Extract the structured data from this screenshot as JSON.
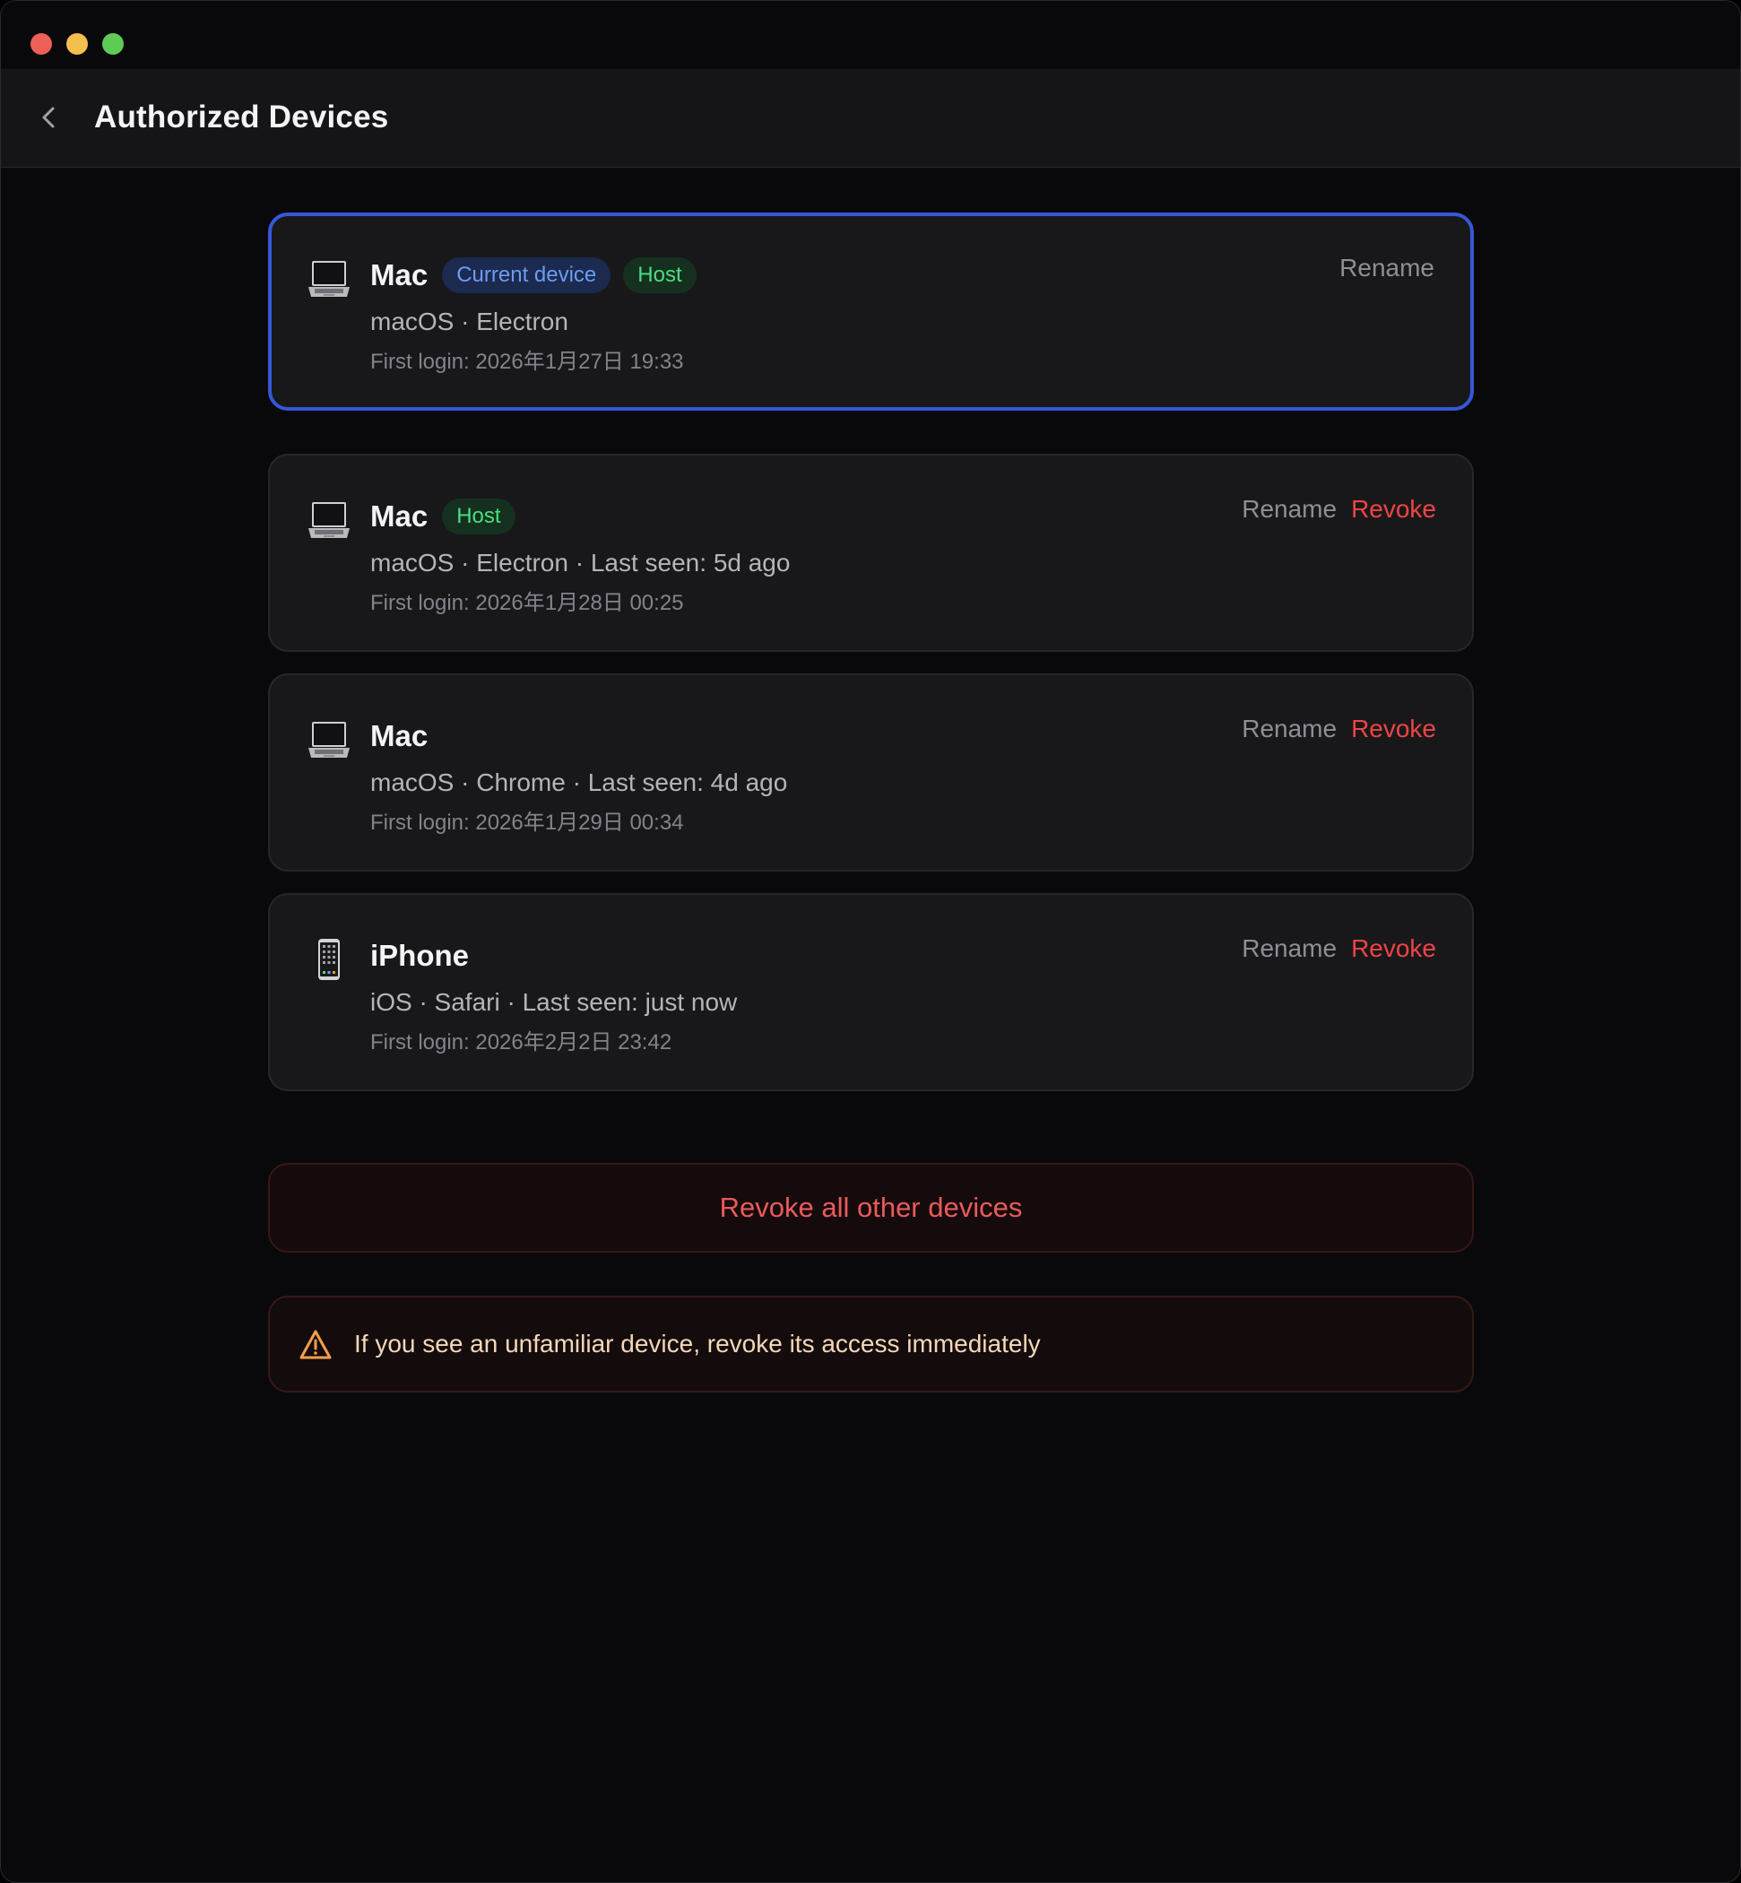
{
  "window": {
    "title": "Authorized Devices"
  },
  "header": {
    "back_icon": "chevron-left-icon",
    "title": "Authorized Devices"
  },
  "colors": {
    "accent_blue": "#3558d6",
    "host_green": "#4ade80",
    "revoke_red": "#ef4444",
    "warning_orange": "#f59e4b"
  },
  "devices": [
    {
      "icon": "laptop-icon",
      "name": "Mac",
      "badges": [
        "Current device",
        "Host"
      ],
      "meta": "macOS · Electron",
      "first_login": "First login: 2026年1月27日 19:33",
      "rename_label": "Rename",
      "revoke_label": null,
      "current": true
    },
    {
      "icon": "laptop-icon",
      "name": "Mac",
      "badges": [
        "Host"
      ],
      "meta": "macOS · Electron · Last seen: 5d ago",
      "first_login": "First login: 2026年1月28日 00:25",
      "rename_label": "Rename",
      "revoke_label": "Revoke",
      "current": false
    },
    {
      "icon": "laptop-icon",
      "name": "Mac",
      "badges": [],
      "meta": "macOS · Chrome · Last seen: 4d ago",
      "first_login": "First login: 2026年1月29日 00:34",
      "rename_label": "Rename",
      "revoke_label": "Revoke",
      "current": false
    },
    {
      "icon": "phone-icon",
      "name": "iPhone",
      "badges": [],
      "meta": "iOS · Safari · Last seen: just now",
      "first_login": "First login: 2026年2月2日 23:42",
      "rename_label": "Rename",
      "revoke_label": "Revoke",
      "current": false
    }
  ],
  "revoke_all": {
    "label": "Revoke all other devices"
  },
  "warning": {
    "icon": "warning-triangle-icon",
    "text": "If you see an unfamiliar device, revoke its access immediately"
  }
}
